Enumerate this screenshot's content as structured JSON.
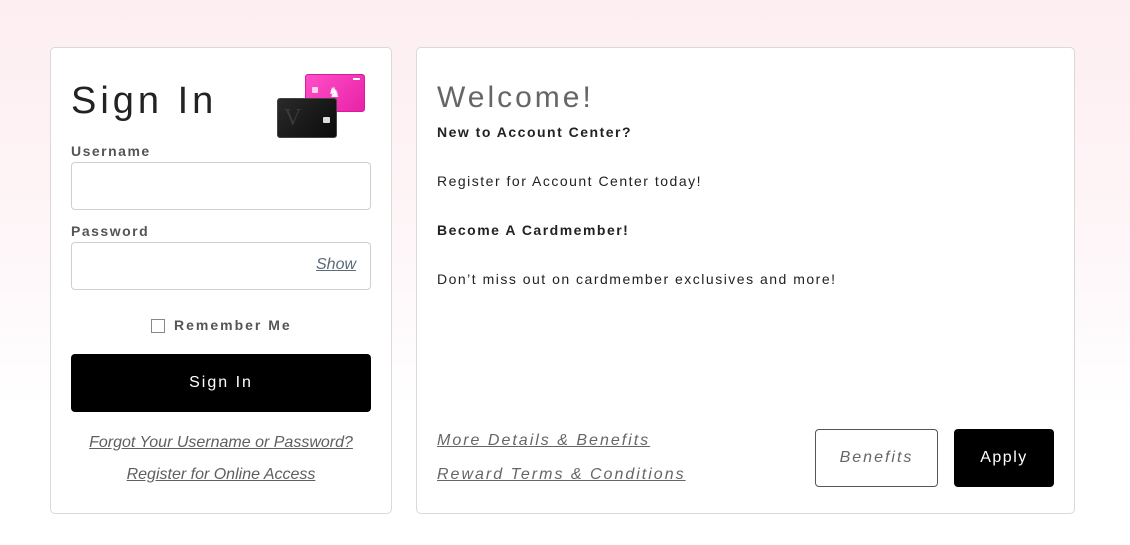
{
  "signin": {
    "title": "Sign In",
    "username_label": "Username",
    "username_value": "",
    "password_label": "Password",
    "password_value": "",
    "show_label": "Show",
    "remember_label": "Remember Me",
    "remember_checked": false,
    "signin_button": "Sign In",
    "forgot_link": "Forgot Your Username or Password?",
    "register_link": "Register for Online Access"
  },
  "welcome": {
    "title": "Welcome!",
    "new_heading": "New to Account Center?",
    "register_text": "Register for Account Center today!",
    "become_heading": "Become A Cardmember!",
    "dont_miss_text": "Don’t miss out on cardmember exclusives and more!",
    "details_link": "More Details & Benefits",
    "terms_link": "Reward Terms & Conditions",
    "benefits_button": "Benefits",
    "apply_button": "Apply"
  },
  "colors": {
    "button_black": "#000000",
    "card_pink": "#ff4fc8",
    "card_black": "#111111",
    "link_gray": "#5f5f5f",
    "background_pink": "#fdeef1"
  },
  "icons": {
    "credit_cards": "credit-cards-icon",
    "checkbox": "checkbox-icon"
  }
}
